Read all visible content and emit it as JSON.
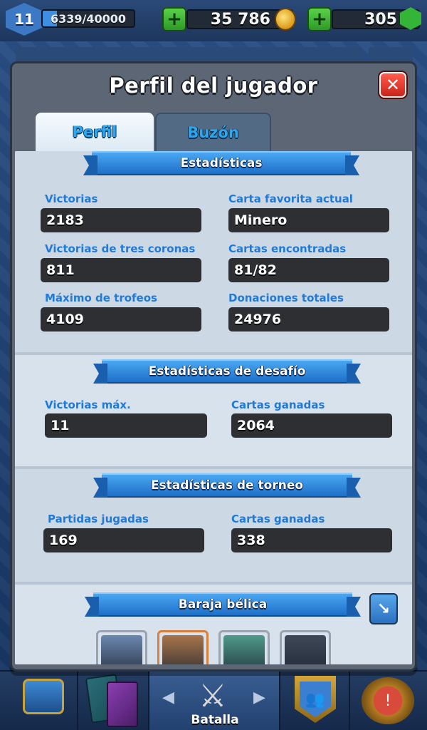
{
  "topbar": {
    "level": "11",
    "xp_text": "6339/40000",
    "xp_fraction": 0.158,
    "gold": "35 786",
    "gems": "305",
    "plus_symbol": "+",
    "gold_icon": "gold-coin-icon",
    "gem_icon": "gem-icon"
  },
  "modal": {
    "title": "Perfil del jugador",
    "close_symbol": "✕",
    "tabs": [
      {
        "label": "Perfil",
        "active": true
      },
      {
        "label": "Buzón",
        "active": false
      }
    ]
  },
  "stats": {
    "header": "Estadísticas",
    "items": [
      {
        "label": "Victorias",
        "value": "2183"
      },
      {
        "label": "Carta favorita actual",
        "value": "Minero"
      },
      {
        "label": "Victorias de tres coronas",
        "value": "811"
      },
      {
        "label": "Cartas encontradas",
        "value": "81/82"
      },
      {
        "label": "Máximo de trofeos",
        "value": "4109"
      },
      {
        "label": "Donaciones totales",
        "value": "24976"
      }
    ]
  },
  "challenge": {
    "header": "Estadísticas de desafío",
    "items": [
      {
        "label": "Victorias máx.",
        "value": "11"
      },
      {
        "label": "Cartas ganadas",
        "value": "2064"
      }
    ]
  },
  "tournament": {
    "header": "Estadísticas de torneo",
    "items": [
      {
        "label": "Partidas jugadas",
        "value": "169"
      },
      {
        "label": "Cartas ganadas",
        "value": "338"
      }
    ]
  },
  "deck": {
    "header": "Baraja bélica",
    "expand_icon": "expand-arrow-icon",
    "cards": [
      {
        "icon": "card-miner-icon",
        "color": "#6b88b0"
      },
      {
        "icon": "card-hog-rider-icon",
        "color": "#a8744a"
      },
      {
        "icon": "card-goblin-cage-icon",
        "color": "#4f9a8a"
      },
      {
        "icon": "card-dark-knight-icon",
        "color": "#3f4858"
      }
    ]
  },
  "bottom_nav": {
    "battle_label": "Batalla",
    "left_arrow": "◀",
    "right_arrow": "▶"
  },
  "colors": {
    "accent_blue": "#1f7ad8",
    "value_bg": "#2d2f33",
    "panel": "#ccd8e4",
    "close_red": "#c9241a",
    "plus_green": "#2d9a26"
  }
}
